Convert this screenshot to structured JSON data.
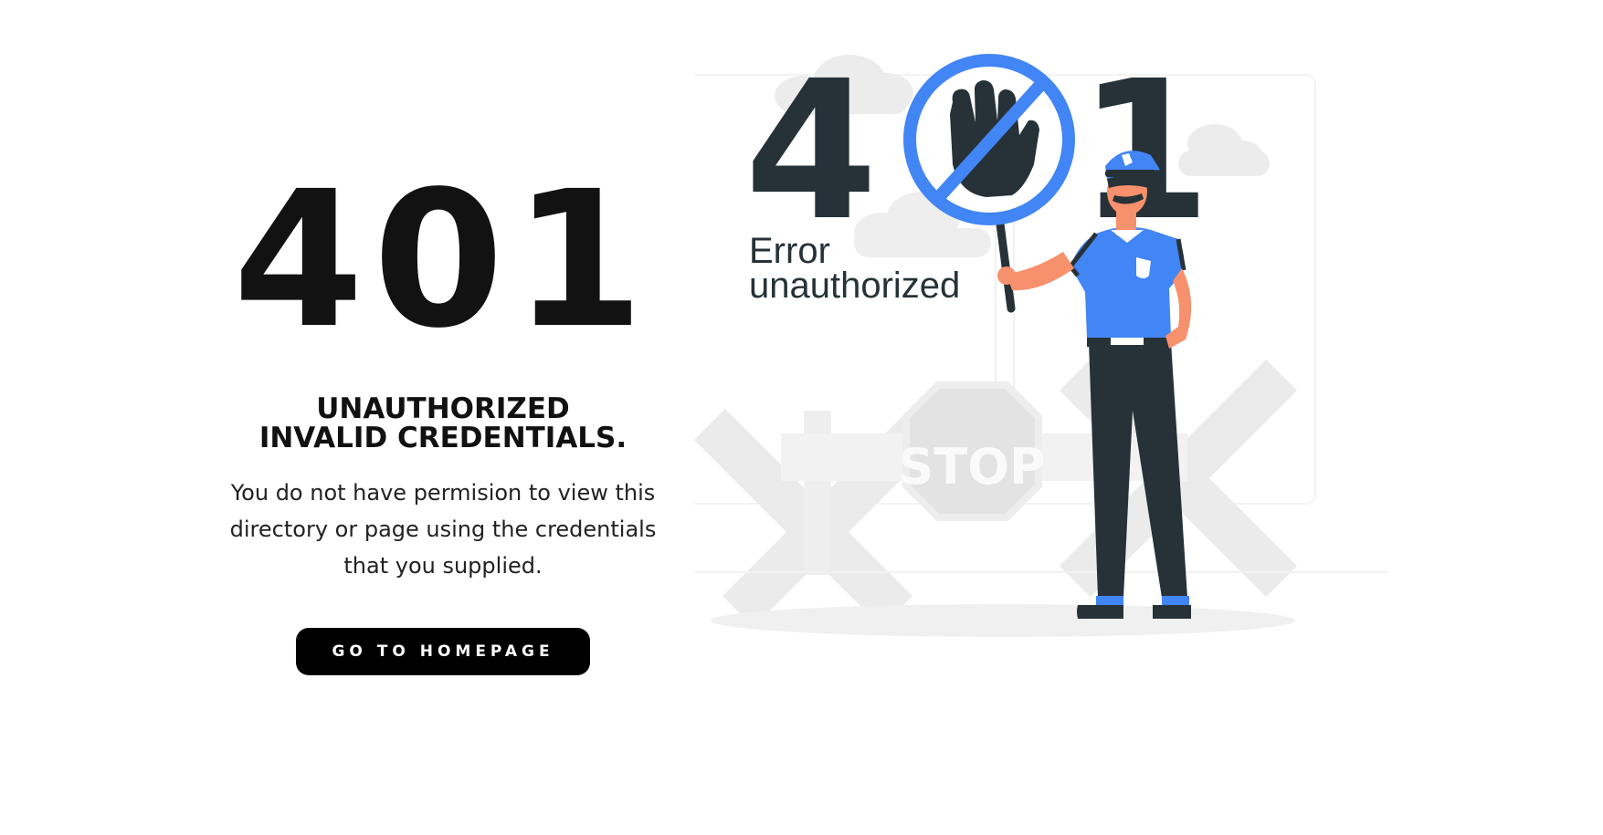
{
  "error_code": "401",
  "headline": {
    "line1": "UNAUTHORIZED",
    "line2": "INVALID CREDENTIALS."
  },
  "description": "You do not have permision to view this directory or page using the credentials that you supplied.",
  "button": {
    "label": "GO TO HOMEPAGE"
  },
  "illustration": {
    "digit_left": "4",
    "digit_right": "1",
    "caption_line1": "Error",
    "caption_line2": "unauthorized",
    "stop_sign_text": "STOP",
    "icons": [
      "stop-hand-icon",
      "police-officer-icon",
      "stop-sign-icon",
      "cloud-icon"
    ]
  },
  "colors": {
    "text": "#121212",
    "button_bg": "#000000",
    "button_text": "#ffffff",
    "accent_blue": "#4285f4",
    "dark_navy": "#263238",
    "skin": "#f7906c",
    "background_grey": "#ebebeb"
  }
}
